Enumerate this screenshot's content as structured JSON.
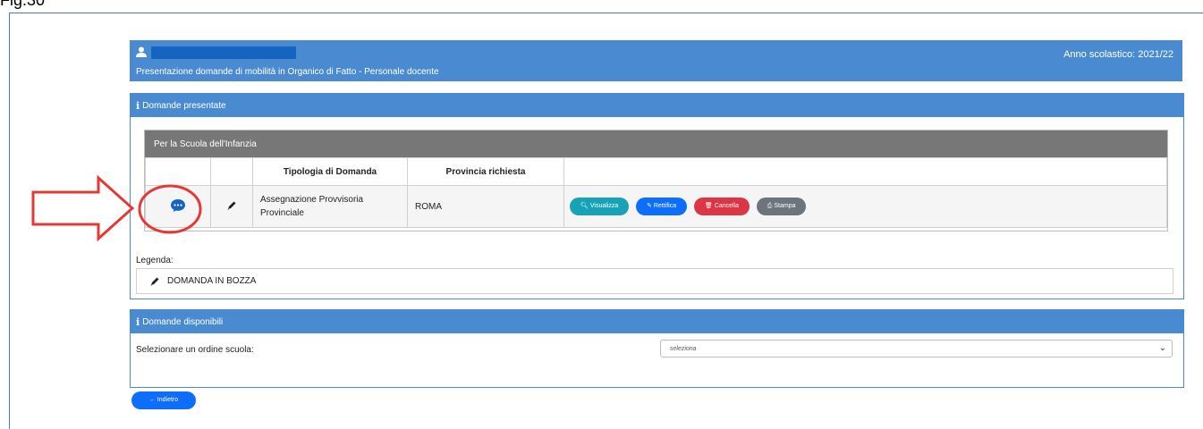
{
  "figure": {
    "label": "Fig.30"
  },
  "header": {
    "title": "Presentazione domande di mobilità in Organico di Fatto - Personale docente",
    "school_year": "Anno scolastico: 2021/22",
    "icon": "user-icon"
  },
  "domande_presentate": {
    "heading": "Domande presentate",
    "section_title": "Per la Scuola dell'Infanzia",
    "columns": [
      "",
      "",
      "Tipologia di Domanda",
      "Provincia richiesta",
      ""
    ],
    "rows": [
      {
        "tipologia": "Assegnazione Provvisoria Provinciale",
        "provincia": "ROMA",
        "actions": {
          "visualizza": "Visualizza",
          "rettifica": "Rettifica",
          "cancella": "Cancella",
          "stampa": "Stampa"
        }
      }
    ],
    "legend_title": "Legenda:",
    "legend_item": "DOMANDA IN BOZZA"
  },
  "domande_disponibili": {
    "heading": "Domande disponibili",
    "select_label": "Selezionare un ordine scuola:",
    "select_value": "seleziona"
  },
  "footer": {
    "back_label": "← Indietro"
  },
  "colors": {
    "primary": "#4a8ad0",
    "highlight": "#e53935",
    "teal": "#17a2b8",
    "blue": "#0d6efd",
    "red": "#dc3545",
    "grey": "#6c757d"
  }
}
